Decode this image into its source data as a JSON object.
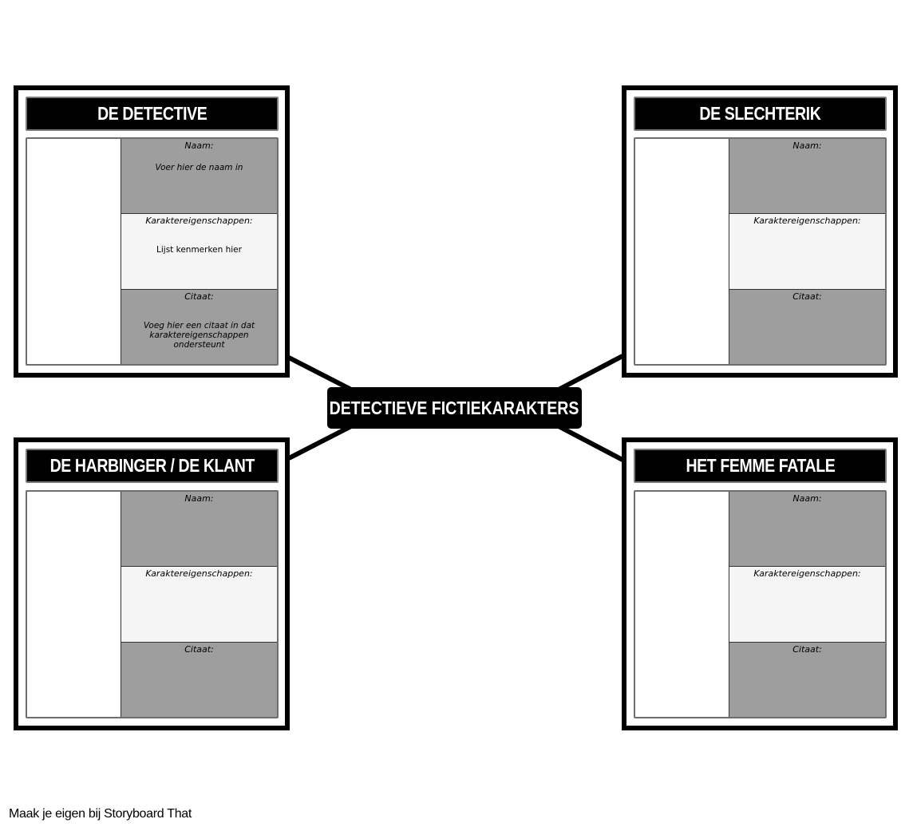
{
  "center_title": "DETECTIEVE FICTIEKARAKTERS",
  "field_labels": {
    "name": "Naam:",
    "traits": "Karaktereigenschappen:",
    "quote": "Citaat:"
  },
  "cards": [
    {
      "title": "DE DETECTIVE",
      "name_hint": "Voer hier de naam in",
      "traits_hint": "Lijst kenmerken hier",
      "quote_hint": "Voeg hier een citaat in dat karaktereigenschappen ondersteunt"
    },
    {
      "title": "DE SLECHTERIK",
      "name_hint": "",
      "traits_hint": "",
      "quote_hint": ""
    },
    {
      "title": "DE HARBINGER / DE KLANT",
      "name_hint": "",
      "traits_hint": "",
      "quote_hint": ""
    },
    {
      "title": "HET FEMME FATALE",
      "name_hint": "",
      "traits_hint": "",
      "quote_hint": ""
    }
  ],
  "colors": {
    "frame": "#000000",
    "field_gray": "#9e9e9e",
    "field_light": "#f5f5f5"
  },
  "footer": "Maak je eigen bij Storyboard That"
}
